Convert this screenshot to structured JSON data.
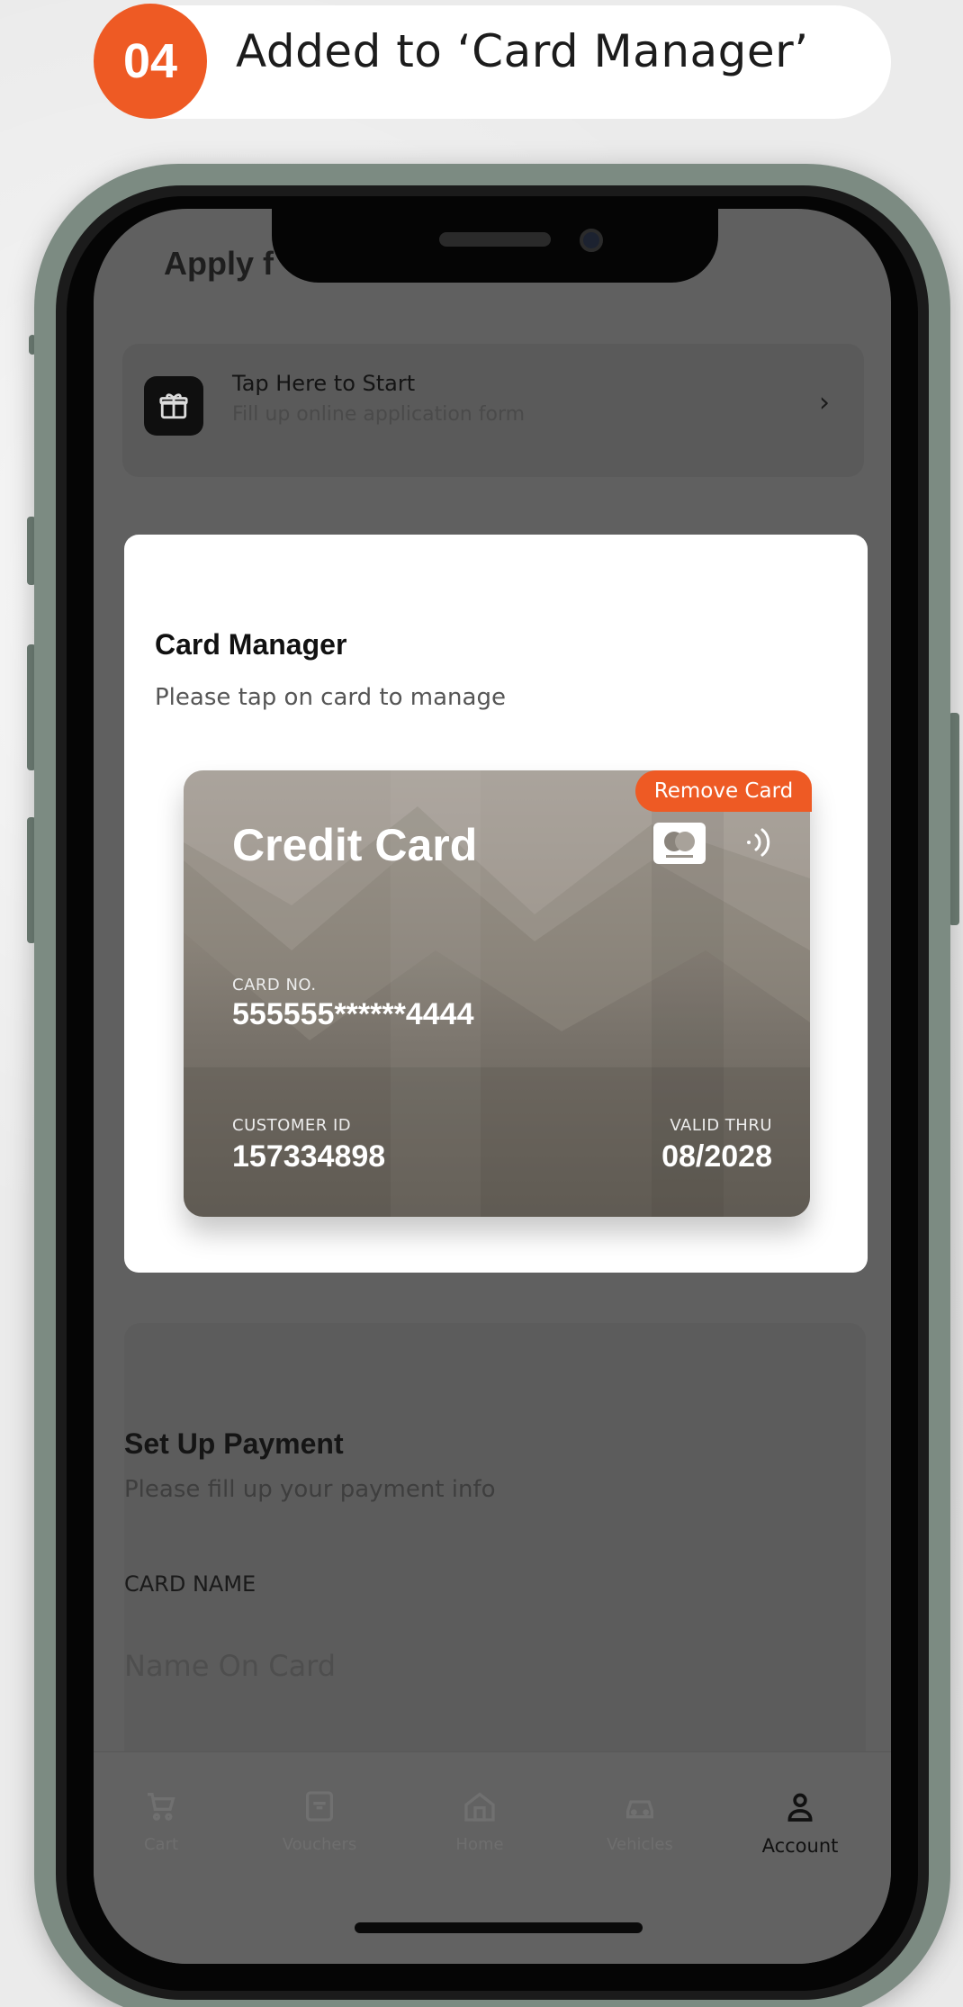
{
  "step": {
    "number": "04",
    "title": "Added to ‘Card Manager’"
  },
  "background": {
    "title": "Apply f",
    "tap_row": {
      "title": "Tap Here to Start",
      "subtitle": "Fill up online application form",
      "chevron": "›",
      "icon": "gift-icon"
    }
  },
  "card_manager": {
    "title": "Card Manager",
    "subtitle": "Please tap on card to manage",
    "card": {
      "type_label": "Credit Card",
      "remove_label": "Remove Card",
      "card_no_label": "CARD NO.",
      "card_no": "555555******4444",
      "customer_id_label": "CUSTOMER ID",
      "customer_id": "157334898",
      "valid_thru_label": "VALID THRU",
      "valid_thru": "08/2028",
      "brand_icon": "card-brand-icon",
      "contactless_icon": "contactless-icon"
    }
  },
  "setup_payment": {
    "title": "Set Up Payment",
    "subtitle": "Please fill up your payment info",
    "card_name_label": "CARD NAME",
    "card_name_placeholder": "Name On Card"
  },
  "tabbar": {
    "tabs": [
      {
        "label": "Cart",
        "icon": "cart-icon",
        "active": false
      },
      {
        "label": "Vouchers",
        "icon": "voucher-icon",
        "active": false
      },
      {
        "label": "Home",
        "icon": "home-icon",
        "active": false
      },
      {
        "label": "Vehicles",
        "icon": "car-icon",
        "active": false
      },
      {
        "label": "Account",
        "icon": "user-icon",
        "active": true
      }
    ]
  },
  "colors": {
    "accent": "#ee5a24",
    "overlay": "#606060",
    "card_top": "#a39d95",
    "card_bottom": "#615c54"
  }
}
